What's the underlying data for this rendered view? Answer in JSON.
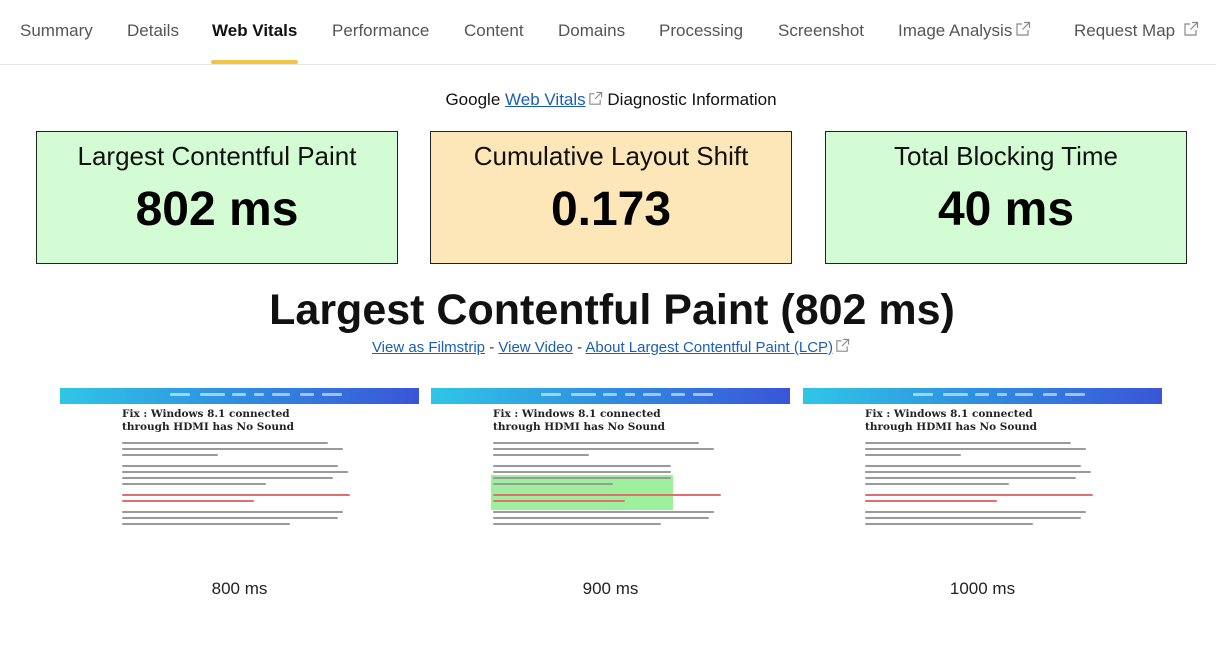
{
  "tabs": [
    {
      "label": "Summary",
      "external": false,
      "active": false
    },
    {
      "label": "Details",
      "external": false,
      "active": false
    },
    {
      "label": "Web Vitals",
      "external": false,
      "active": true
    },
    {
      "label": "Performance",
      "external": false,
      "active": false
    },
    {
      "label": "Content",
      "external": false,
      "active": false
    },
    {
      "label": "Domains",
      "external": false,
      "active": false
    },
    {
      "label": "Processing",
      "external": false,
      "active": false
    },
    {
      "label": "Screenshot",
      "external": false,
      "active": false
    },
    {
      "label": "Image Analysis",
      "external": true,
      "active": false
    },
    {
      "label": "Request Map",
      "external": true,
      "active": false
    }
  ],
  "header": {
    "prefix": "Google",
    "link": "Web Vitals",
    "suffix": "Diagnostic Information"
  },
  "metrics": [
    {
      "label": "Largest Contentful Paint",
      "value": "802 ms",
      "rating": "good",
      "color": "#d4fcd4"
    },
    {
      "label": "Cumulative Layout Shift",
      "value": "0.173",
      "rating": "needs-improvement",
      "color": "#fde6b8"
    },
    {
      "label": "Total Blocking Time",
      "value": "40 ms",
      "rating": "good",
      "color": "#d4fcd4"
    }
  ],
  "lcp": {
    "title": "Largest Contentful Paint (802 ms)",
    "link_filmstrip": "View as Filmstrip",
    "link_video": "View Video",
    "link_about": "About Largest Contentful Paint (LCP)",
    "separator": "-"
  },
  "filmstrip": [
    {
      "time": "800 ms",
      "title": "Fix : Windows 8.1 connected through HDMI has No Sound",
      "highlighted": false
    },
    {
      "time": "900 ms",
      "title": "Fix : Windows 8.1 connected through HDMI has No Sound",
      "highlighted": true
    },
    {
      "time": "1000 ms",
      "title": "Fix : Windows 8.1 connected through HDMI has No Sound",
      "highlighted": false
    }
  ],
  "colors": {
    "active_tab_underline": "#f4c542",
    "link": "#1a5fb4",
    "lcp_highlight": "#9ef09e"
  },
  "icons": {
    "external_link": "external-link-icon"
  }
}
